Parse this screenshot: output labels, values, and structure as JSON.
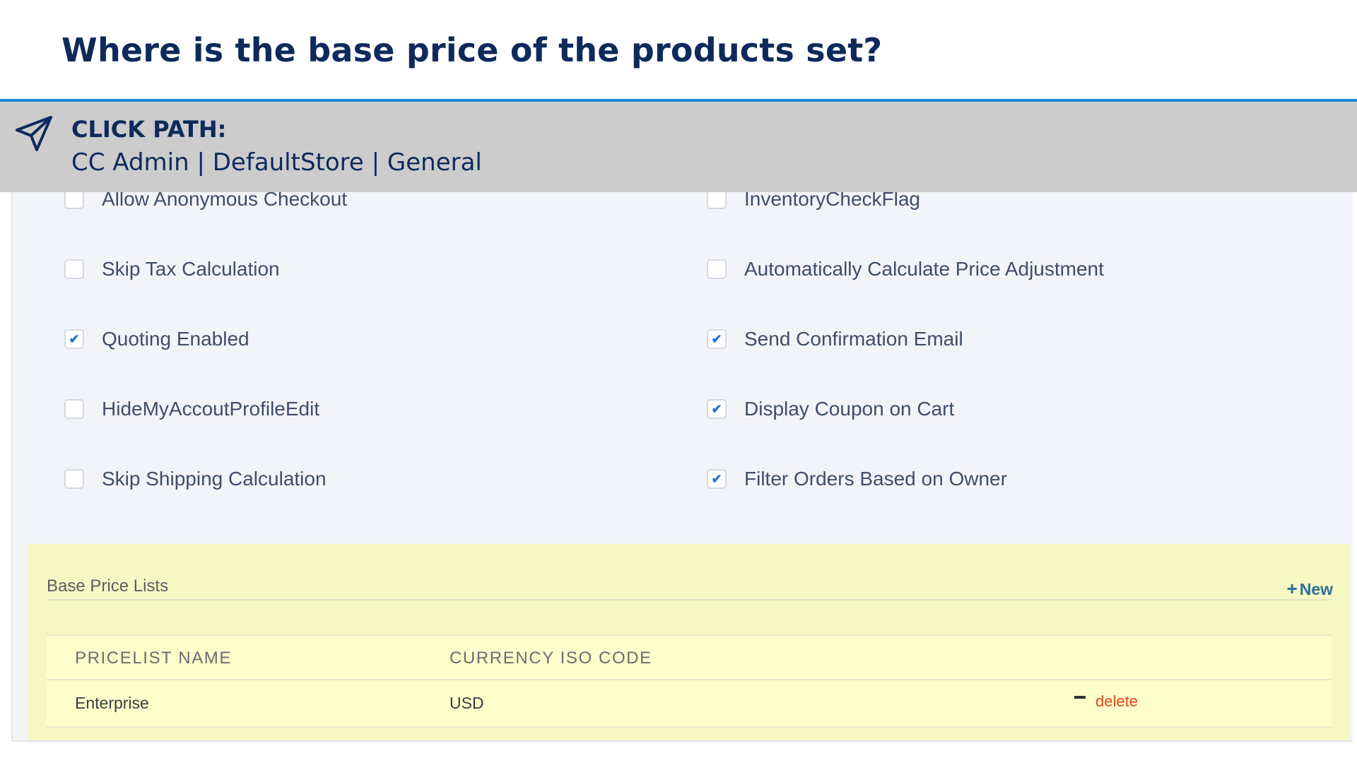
{
  "slide": {
    "title": "Where is the base price of the products set?"
  },
  "click_path": {
    "heading": "CLICK PATH:",
    "path": "CC Admin | DefaultStore | General",
    "icon": "paper-plane-icon"
  },
  "settings": {
    "left_column": [
      {
        "label": "Allow Anonymous Checkout",
        "checked": false
      },
      {
        "label": "Skip Tax Calculation",
        "checked": false
      },
      {
        "label": "Quoting Enabled",
        "checked": true
      },
      {
        "label": "HideMyAccoutProfileEdit",
        "checked": false
      },
      {
        "label": "Skip Shipping Calculation",
        "checked": false
      }
    ],
    "right_column": [
      {
        "label": "InventoryCheckFlag",
        "checked": false
      },
      {
        "label": "Automatically Calculate Price Adjustment",
        "checked": false
      },
      {
        "label": "Send Confirmation Email",
        "checked": true
      },
      {
        "label": "Display Coupon on Cart",
        "checked": true
      },
      {
        "label": "Filter Orders Based on Owner",
        "checked": true
      }
    ],
    "check_mark": "✔"
  },
  "base_price_lists": {
    "title": "Base Price Lists",
    "new_label": "New",
    "new_icon": "+",
    "columns": [
      "PRICELIST NAME",
      "CURRENCY ISO CODE"
    ],
    "rows": [
      {
        "name": "Enterprise",
        "currency": "USD",
        "action": "delete"
      }
    ]
  },
  "colors": {
    "title": "#0e2a5c",
    "accent_rule": "#1c86d1",
    "click_path_bar": "#cccccc",
    "highlight": "#f6f8c3",
    "checkbox_tick": "#1f74d4",
    "delete": "#e6461b",
    "link": "#2a6f99"
  }
}
